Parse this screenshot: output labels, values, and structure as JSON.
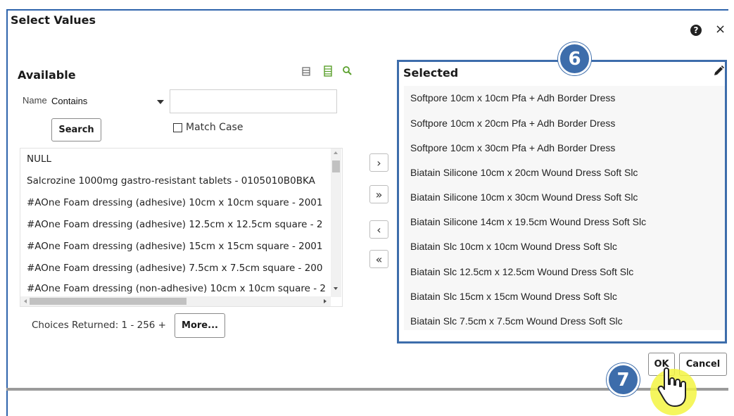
{
  "dialog": {
    "title": "Select Values",
    "help_icon": "help-icon",
    "close_glyph": "×"
  },
  "available": {
    "title": "Available",
    "toolbar_icons": [
      "list-view-icon",
      "table-view-icon",
      "search-icon"
    ],
    "name_label": "Name",
    "operator_value": "Contains",
    "search_input_value": "",
    "search_button": "Search",
    "match_case_label": "Match Case",
    "match_case_checked": false,
    "items": [
      "NULL",
      "Salcrozine 1000mg gastro-resistant tablets - 0105010B0BKA",
      "#AOne Foam dressing (adhesive) 10cm x 10cm square - 2001",
      "#AOne Foam dressing (adhesive) 12.5cm x 12.5cm square - 2",
      "#AOne Foam dressing (adhesive) 15cm x 15cm square - 2001",
      "#AOne Foam dressing (adhesive) 7.5cm x 7.5cm square - 200",
      "#AOne Foam dressing (non-adhesive) 10cm x 10cm square - 2"
    ],
    "choices_returned": "Choices Returned: 1 - 256 +",
    "more_button": "More..."
  },
  "move_buttons": {
    "move_right": "›",
    "move_all_right": "»",
    "move_left": "‹",
    "move_all_left": "«"
  },
  "selected": {
    "title": "Selected",
    "edit_icon": "pencil-icon",
    "items": [
      "Softpore 10cm x 10cm Pfa + Adh Border Dress",
      "Softpore 10cm x 20cm Pfa + Adh Border Dress",
      "Softpore 10cm x 30cm Pfa + Adh Border Dress",
      "Biatain Silicone 10cm x 20cm Wound Dress Soft Slc",
      "Biatain Silicone 10cm x 30cm Wound Dress Soft Slc",
      "Biatain Silicone 14cm x 19.5cm Wound Dress Soft Slc",
      "Biatain Slc 10cm x 10cm Wound Dress Soft Slc",
      "Biatain Slc 12.5cm x 12.5cm Wound Dress Soft Slc",
      "Biatain Slc 15cm x 15cm Wound Dress Soft Slc",
      "Biatain Slc 7.5cm x 7.5cm Wound Dress Soft Slc"
    ]
  },
  "footer": {
    "ok_button": "OK",
    "cancel_button": "Cancel"
  },
  "annotations": {
    "step_6": "6",
    "step_7": "7",
    "pointer_icon": "hand-pointer-icon"
  },
  "colors": {
    "accent_blue": "#3d6dab",
    "toolbar_green": "#5aa02c",
    "highlight_yellow": "#f3f542"
  }
}
